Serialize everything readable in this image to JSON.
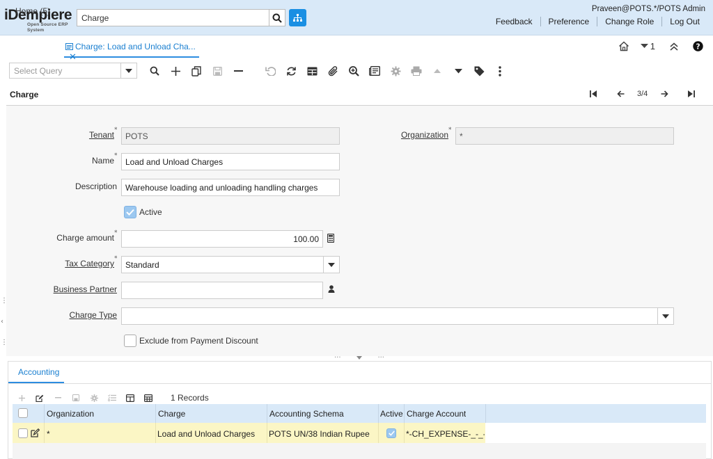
{
  "header": {
    "logo_title": "iDempiere",
    "logo_subtitle": "Open Source ERP System",
    "search_value": "Charge",
    "user": "Praveen@POTS.*/POTS Admin",
    "links": [
      "Feedback",
      "Preference",
      "Change Role",
      "Log Out"
    ]
  },
  "tabs": {
    "home": "Home (5)",
    "active": "Charge: Load and Unload Cha...",
    "counter": "1"
  },
  "toolbar": {
    "query_placeholder": "Select Query"
  },
  "window": {
    "title": "Charge",
    "record_position": "3/4"
  },
  "form": {
    "tenant_label": "Tenant",
    "tenant_value": "POTS",
    "organization_label": "Organization",
    "organization_value": "*",
    "name_label": "Name",
    "name_value": "Load and Unload Charges",
    "description_label": "Description",
    "description_value": "Warehouse loading and unloading handling charges",
    "active_label": "Active",
    "active_checked": true,
    "charge_amount_label": "Charge amount",
    "charge_amount_value": "100.00",
    "tax_category_label": "Tax Category",
    "tax_category_value": "Standard",
    "business_partner_label": "Business Partner",
    "business_partner_value": "",
    "charge_type_label": "Charge Type",
    "charge_type_value": "",
    "exclude_label": "Exclude from Payment Discount",
    "exclude_checked": false
  },
  "accounting": {
    "tab_label": "Accounting",
    "records": "1 Records",
    "columns": [
      "Organization",
      "Charge",
      "Accounting Schema",
      "Active",
      "Charge Account"
    ],
    "rows": [
      {
        "organization": "*",
        "charge": "Load and Unload Charges",
        "schema": "POTS UN/38 Indian Rupee",
        "active": true,
        "account": "*-CH_EXPENSE-_-_-_"
      }
    ]
  },
  "colors": {
    "header_bg": "#d9e9f8",
    "accent": "#1a8fe3",
    "row_highlight": "#fbf6c5"
  }
}
